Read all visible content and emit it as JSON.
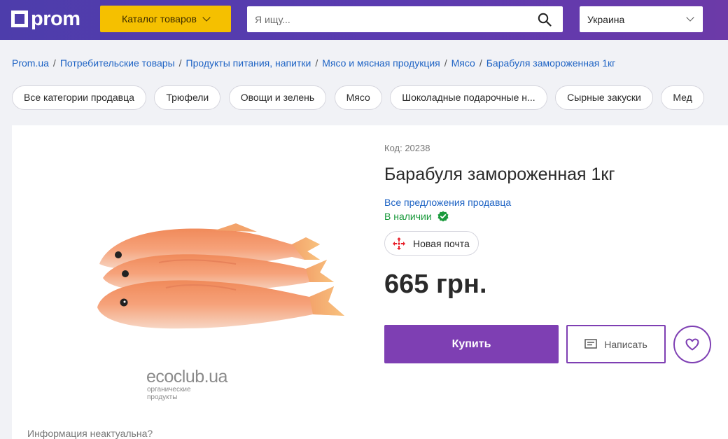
{
  "header": {
    "logo_text": "prom",
    "catalog_label": "Каталог товаров",
    "search_placeholder": "Я ищу...",
    "region": "Украина"
  },
  "breadcrumb": [
    "Prom.ua",
    "Потребительские товары",
    "Продукты питания, напитки",
    "Мясо и мясная продукция",
    "Мясо",
    "Барабуля замороженная 1кг"
  ],
  "categories": [
    "Все категории продавца",
    "Трюфели",
    "Овощи и зелень",
    "Мясо",
    "Шоколадные подарочные н...",
    "Сырные закуски",
    "Мед"
  ],
  "product": {
    "code": "Код: 20238",
    "title": "Барабуля замороженная 1кг",
    "seller_link": "Все предложения продавца",
    "stock": "В наличии",
    "delivery": "Новая почта",
    "price": "665 грн.",
    "buy_label": "Купить",
    "write_label": "Написать",
    "image_brand": "ecoclub.ua",
    "image_brand_sub": "органические продукты",
    "info_link": "Информация неактуальна?"
  },
  "colors": {
    "header_start": "#4d3dab",
    "header_end": "#6c3aa8",
    "catalog": "#f5c000",
    "primary": "#7e3fb3",
    "link": "#1e63c4",
    "stock": "#1a9a3c",
    "nova_poshta": "#e8202a"
  },
  "icons": {
    "search": "search-icon",
    "favorite": "heart-icon",
    "message": "message-icon",
    "stock": "check-badge-icon",
    "delivery": "nova-poshta-icon"
  }
}
